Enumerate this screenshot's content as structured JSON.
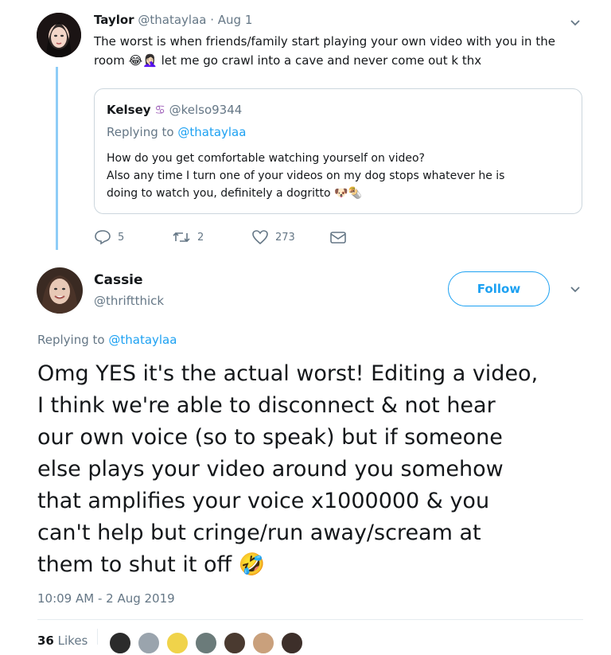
{
  "parent_tweet": {
    "name": "Taylor",
    "handle": "@thataylaa",
    "date": "· Aug 1",
    "text_line1": "The worst is when friends/family start playing your own video with you in the",
    "text_line2_prefix": "room",
    "text_line2_emojis": "😂🤦🏻‍♀️",
    "text_line2_suffix": "let me go crawl into a cave and never come out k thx",
    "quoted": {
      "name": "Kelsey",
      "name_emoji": "♋",
      "handle": "@kelso9344",
      "replying_prefix": "Replying to",
      "replying_handle": "@thataylaa",
      "line1": "How do you get comfortable watching yourself on video?",
      "line2": "Also any time I turn one of your videos on my dog stops whatever he is",
      "line3": "doing to watch you, definitely a dogritto",
      "line3_emojis": "🐶🌯"
    },
    "actions": {
      "replies": "5",
      "retweets": "2",
      "likes": "273"
    }
  },
  "main_tweet": {
    "name": "Cassie",
    "handle": "@thriftthick",
    "follow_label": "Follow",
    "replying_prefix": "Replying to",
    "replying_handle": "@thataylaa",
    "text_line1": "Omg YES it's the actual worst! Editing a video,",
    "text_line2": "I think we're able to disconnect & not hear",
    "text_line3": "our own voice (so to speak) but if someone",
    "text_line4": "else plays your video around you somehow",
    "text_line5": "that amplifies your voice x1000000 & you",
    "text_line6": "can't help but cringe/run away/scream at",
    "text_line7": "them to shut it off",
    "text_emoji": "🤣",
    "timestamp": "10:09 AM - 2 Aug 2019",
    "likes_count": "36",
    "likes_label": "Likes"
  },
  "colors": {
    "accent": "#1da1f2",
    "muted": "#657786",
    "thread_line": "#8ecdf7",
    "border": "#ccd6dd"
  }
}
